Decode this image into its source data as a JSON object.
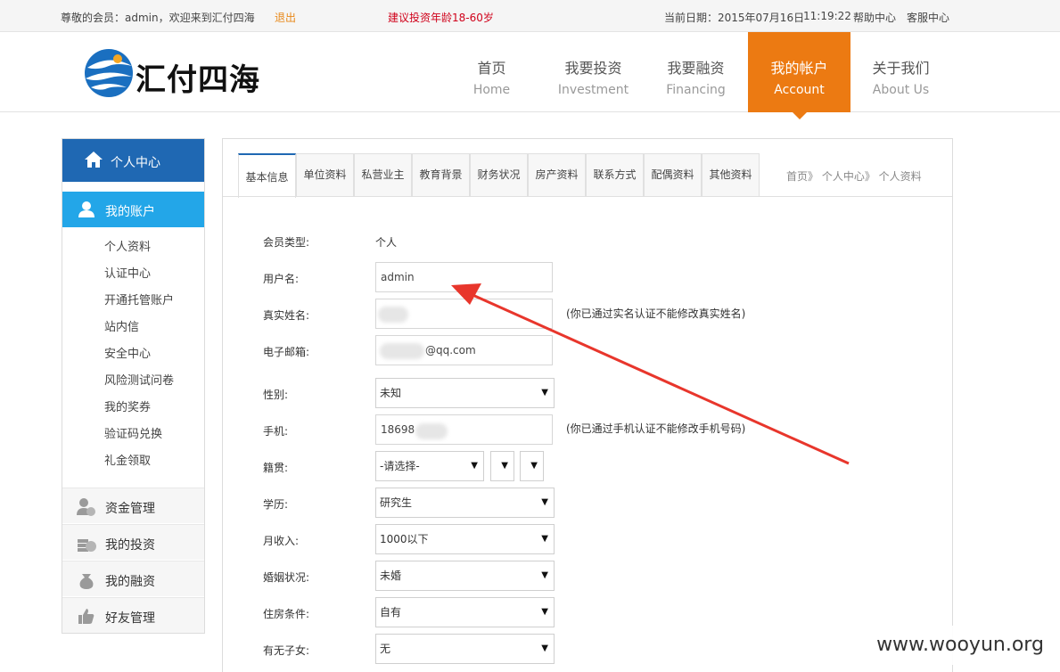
{
  "topbar": {
    "greeting": "尊敬的会员：admin，欢迎来到汇付四海",
    "logout": "退出",
    "advice": "建议投资年龄18-60岁",
    "date": "当前日期：2015年07月16日",
    "time": "11:19:22",
    "help": "帮助中心",
    "service": "客服中心"
  },
  "logo": {
    "text": "汇付四海"
  },
  "nav": [
    {
      "cn": "首页",
      "en": "Home"
    },
    {
      "cn": "我要投资",
      "en": "Investment"
    },
    {
      "cn": "我要融资",
      "en": "Financing"
    },
    {
      "cn": "我的帐户",
      "en": "Account"
    },
    {
      "cn": "关于我们",
      "en": "About Us"
    }
  ],
  "sidebar": {
    "title": "个人中心",
    "section": "我的账户",
    "links": [
      "个人资料",
      "认证中心",
      "开通托管账户",
      "站内信",
      "安全中心",
      "风险测试问卷",
      "我的奖券",
      "验证码兑换",
      "礼金领取"
    ],
    "groups": [
      "资金管理",
      "我的投资",
      "我的融资",
      "好友管理"
    ]
  },
  "tabs": [
    "基本信息",
    "单位资料",
    "私营业主",
    "教育背景",
    "财务状况",
    "房产资料",
    "联系方式",
    "配偶资料",
    "其他资料"
  ],
  "breadcrumb": "首页》 个人中心》 个人资料",
  "form": {
    "member_type_label": "会员类型:",
    "member_type_value": "个人",
    "username_label": "用户名:",
    "username_value": "admin",
    "realname_label": "真实姓名:",
    "realname_note": "(你已通过实名认证不能修改真实姓名)",
    "email_label": "电子邮箱:",
    "email_value": "@qq.com",
    "gender_label": "性别:",
    "gender_value": "未知",
    "phone_label": "手机:",
    "phone_value": "18698",
    "phone_note": "(你已通过手机认证不能修改手机号码)",
    "native_label": "籍贯:",
    "native_value": "-请选择-",
    "education_label": "学历:",
    "education_value": "研究生",
    "income_label": "月收入:",
    "income_value": "1000以下",
    "marriage_label": "婚姻状况:",
    "marriage_value": "未婚",
    "housing_label": "住房条件:",
    "housing_value": "自有",
    "children_label": "有无子女:",
    "children_value": "无"
  },
  "watermark": "www.wooyun.org",
  "colors": {
    "brand_blue": "#1f68b3",
    "light_blue": "#23a6e8",
    "orange": "#ec7a12",
    "arrow_red": "#e8362c"
  }
}
